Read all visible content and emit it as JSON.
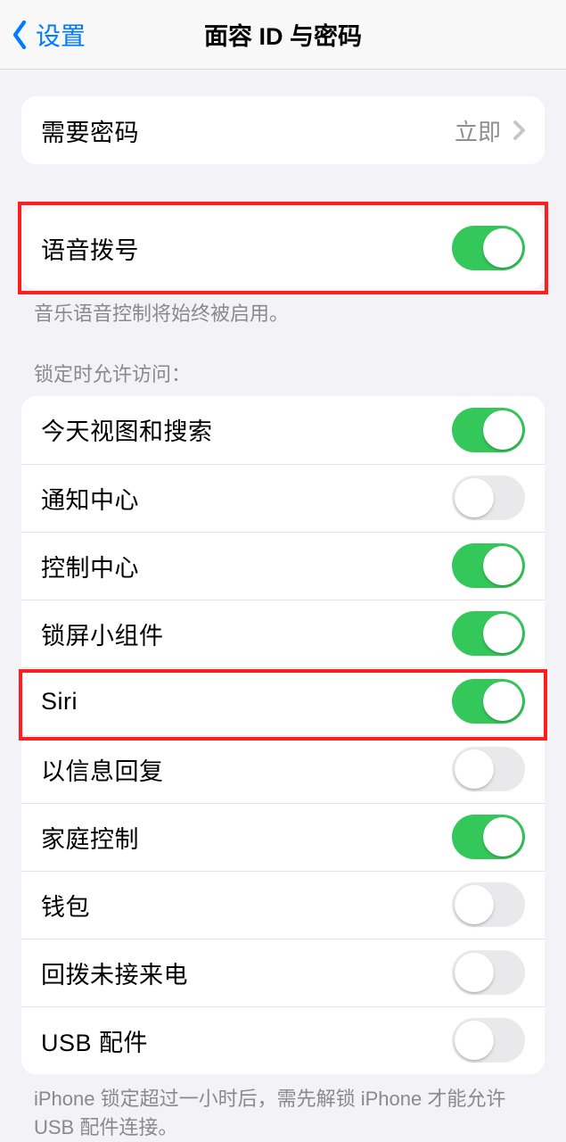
{
  "nav": {
    "back_label": "设置",
    "title": "面容 ID 与密码"
  },
  "require_passcode": {
    "label": "需要密码",
    "value": "立即"
  },
  "voice_dial": {
    "label": "语音拨号",
    "on": true,
    "footer": "音乐语音控制将始终被启用。"
  },
  "allow_access_header": "锁定时允许访问：",
  "allow_access_items": [
    {
      "label": "今天视图和搜索",
      "on": true
    },
    {
      "label": "通知中心",
      "on": false
    },
    {
      "label": "控制中心",
      "on": true
    },
    {
      "label": "锁屏小组件",
      "on": true
    },
    {
      "label": "Siri",
      "on": true
    },
    {
      "label": "以信息回复",
      "on": false
    },
    {
      "label": "家庭控制",
      "on": true
    },
    {
      "label": "钱包",
      "on": false
    },
    {
      "label": "回拨未接来电",
      "on": false
    },
    {
      "label": "USB 配件",
      "on": false
    }
  ],
  "allow_access_footer": "iPhone 锁定超过一小时后，需先解锁 iPhone 才能允许 USB 配件连接。"
}
